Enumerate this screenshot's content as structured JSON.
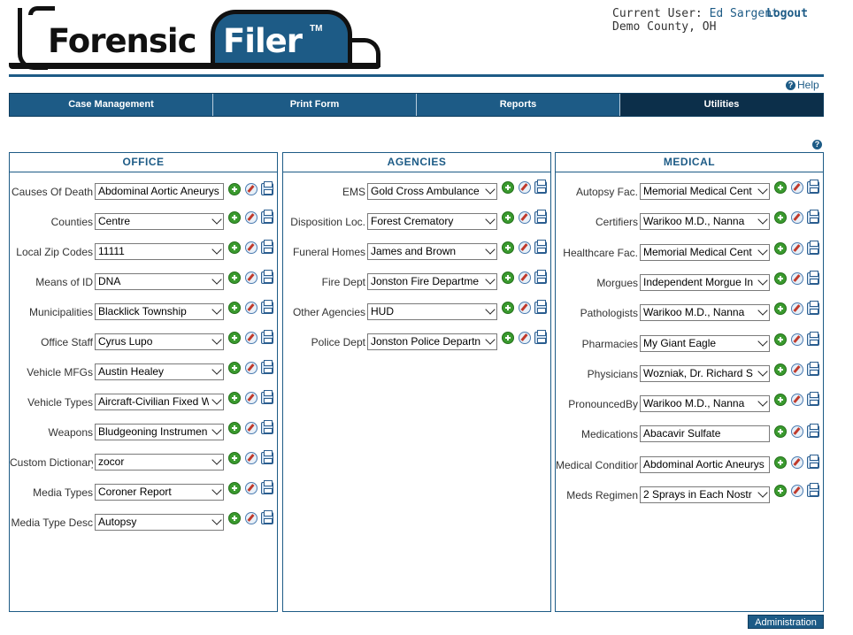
{
  "logo": {
    "word1": "Forensic",
    "word2": "Filer",
    "tm": "TM"
  },
  "user": {
    "label": "Current User:",
    "name": "Ed Sargent",
    "location": "Demo County, OH",
    "logout": "Logout"
  },
  "help": {
    "label": "Help"
  },
  "nav": {
    "tabs": [
      "Case Management",
      "Print Form",
      "Reports",
      "Utilities"
    ],
    "active": "Utilities"
  },
  "colors": {
    "brand": "#1d5b86",
    "nav_active": "#0c2f4a",
    "add_green": "#3a9a2e"
  },
  "office": {
    "title": "OFFICE",
    "rows": [
      {
        "label": "Causes Of Death",
        "value": "Abdominal Aortic Aneurys",
        "kind": "input"
      },
      {
        "label": "Counties",
        "value": "Centre",
        "kind": "select"
      },
      {
        "label": "Local Zip Codes",
        "value": "11111",
        "kind": "select"
      },
      {
        "label": "Means of ID",
        "value": "DNA",
        "kind": "select"
      },
      {
        "label": "Municipalities",
        "value": "Blacklick Township",
        "kind": "select"
      },
      {
        "label": "Office Staff",
        "value": "Cyrus Lupo",
        "kind": "select"
      },
      {
        "label": "Vehicle MFGs",
        "value": "Austin Healey",
        "kind": "select"
      },
      {
        "label": "Vehicle Types",
        "value": "Aircraft-Civilian Fixed W",
        "kind": "select"
      },
      {
        "label": "Weapons",
        "value": "Bludgeoning Instrumen",
        "kind": "select"
      },
      {
        "label": "Custom Dictionary",
        "value": "zocor",
        "kind": "select"
      },
      {
        "label": "Media Types",
        "value": "Coroner Report",
        "kind": "select"
      },
      {
        "label": "Media Type Desc",
        "value": "Autopsy",
        "kind": "select"
      }
    ]
  },
  "agencies": {
    "title": "AGENCIES",
    "rows": [
      {
        "label": "EMS",
        "value": "Gold Cross Ambulance",
        "kind": "select"
      },
      {
        "label": "Disposition Loc.",
        "value": "Forest Crematory",
        "kind": "select"
      },
      {
        "label": "Funeral Homes",
        "value": "James and Brown",
        "kind": "select"
      },
      {
        "label": "Fire Dept",
        "value": "Jonston Fire Departme",
        "kind": "select"
      },
      {
        "label": "Other Agencies",
        "value": "HUD",
        "kind": "select"
      },
      {
        "label": "Police Dept",
        "value": "Jonston Police Departn",
        "kind": "select"
      }
    ]
  },
  "medical": {
    "title": "MEDICAL",
    "rows": [
      {
        "label": "Autopsy Fac.",
        "value": "Memorial Medical Cent",
        "kind": "select"
      },
      {
        "label": "Certifiers",
        "value": "Warikoo M.D., Nanna",
        "kind": "select"
      },
      {
        "label": "Healthcare Fac.",
        "value": "Memorial Medical Cent",
        "kind": "select"
      },
      {
        "label": "Morgues",
        "value": "Independent Morgue In",
        "kind": "select"
      },
      {
        "label": "Pathologists",
        "value": "Warikoo M.D., Nanna",
        "kind": "select"
      },
      {
        "label": "Pharmacies",
        "value": "My Giant Eagle",
        "kind": "select"
      },
      {
        "label": "Physicians",
        "value": "Wozniak, Dr. Richard S",
        "kind": "select"
      },
      {
        "label": "PronouncedBy",
        "value": "Warikoo M.D., Nanna",
        "kind": "select"
      },
      {
        "label": "Medications",
        "value": "Abacavir Sulfate",
        "kind": "input"
      },
      {
        "label": "Medical Condition",
        "value": "Abdominal Aortic Aneurys",
        "kind": "input"
      },
      {
        "label": "Meds Regimen",
        "value": "2 Sprays in Each Nostr",
        "kind": "select"
      }
    ]
  },
  "admin": {
    "label": "Administration"
  }
}
